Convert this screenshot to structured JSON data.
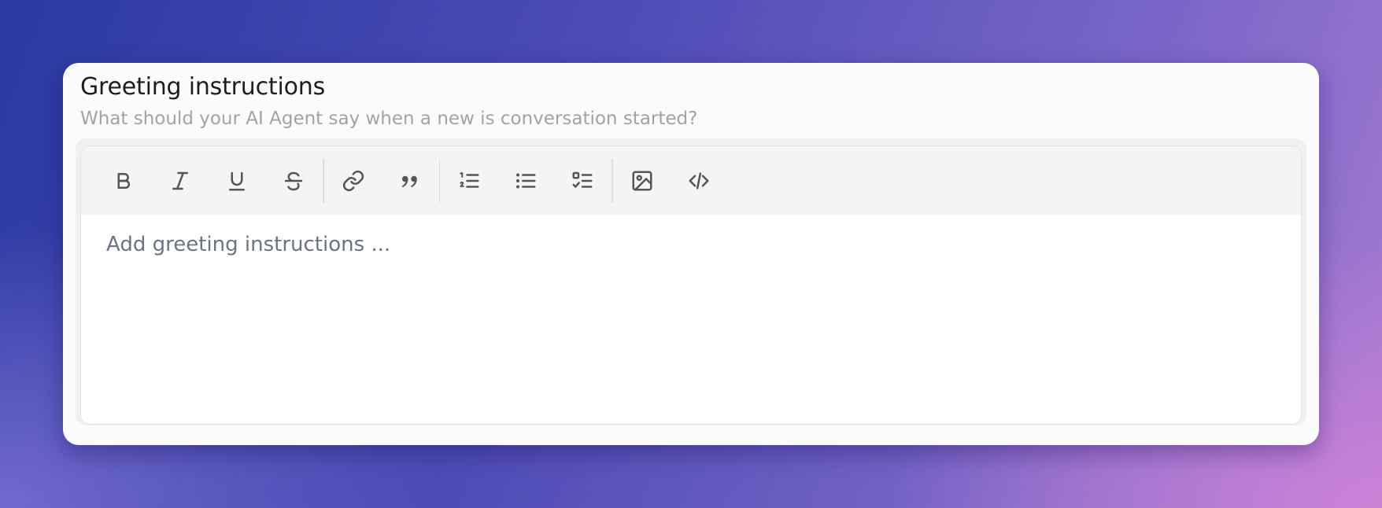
{
  "card": {
    "title": "Greeting instructions",
    "subtitle": "What should your AI Agent say when a new is conversation started?"
  },
  "editor": {
    "placeholder": "Add greeting instructions ...",
    "toolbar": {
      "groups": [
        [
          "bold-icon",
          "italic-icon",
          "underline-icon",
          "strikethrough-icon"
        ],
        [
          "link-icon",
          "quote-icon"
        ],
        [
          "ordered-list-icon",
          "bullet-list-icon",
          "task-list-icon"
        ],
        [
          "image-icon",
          "code-icon"
        ]
      ]
    }
  },
  "colors": {
    "icon": "#555559",
    "placeholder": "#6a7388",
    "subtitle": "#a2a2a8",
    "title": "#1e1e22"
  }
}
